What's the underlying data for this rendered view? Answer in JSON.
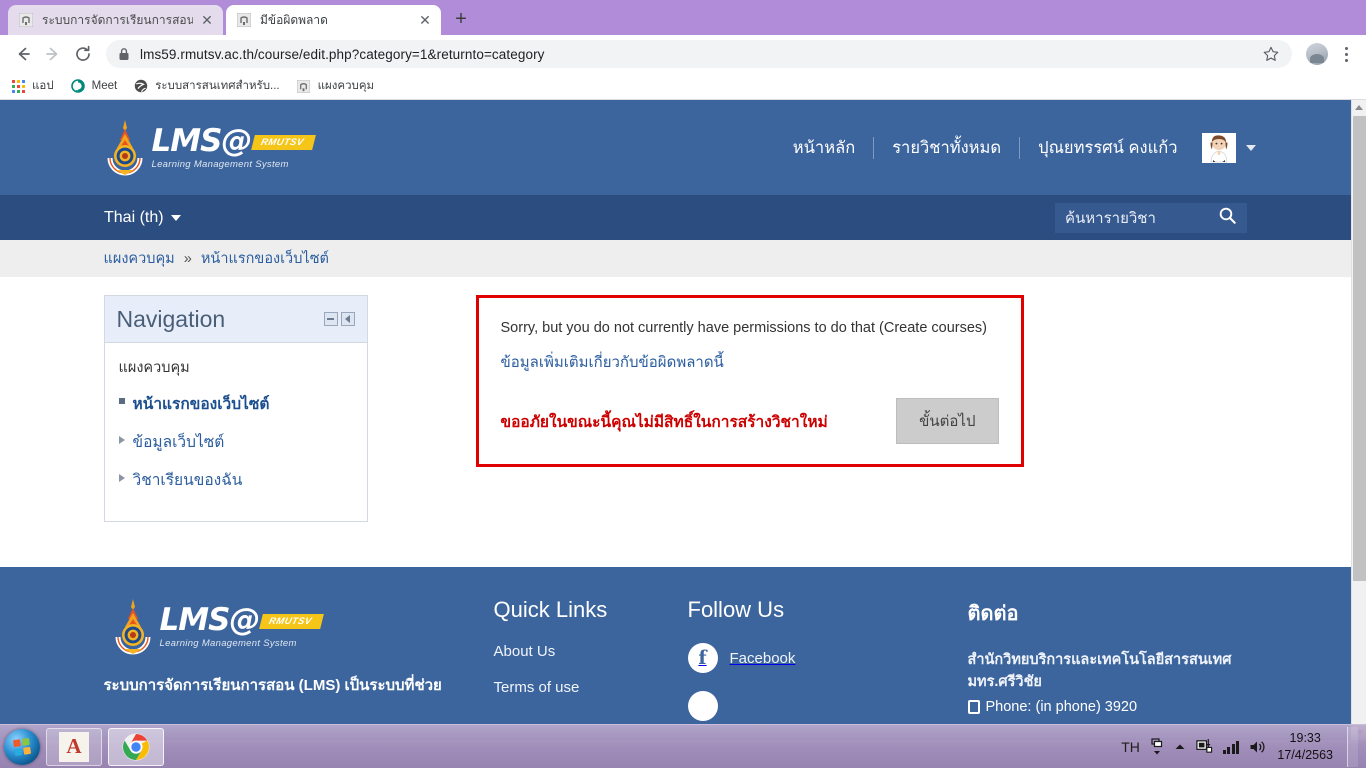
{
  "browser": {
    "tabs": [
      {
        "title": "ระบบการจัดการเรียนการสอน มหาวิทย",
        "favicon": "moodle-favicon",
        "active": false
      },
      {
        "title": "มีข้อผิดพลาด",
        "favicon": "moodle-favicon",
        "active": true
      }
    ],
    "newtab_label": "+",
    "close_label": "✕",
    "nav": {
      "back": "back-arrow",
      "forward": "forward-arrow",
      "reload": "reload-icon"
    },
    "omnibox": {
      "url": "lms59.rmutsv.ac.th/course/edit.php?category=1&returnto=category",
      "lock_icon": "lock-icon"
    },
    "bookmarks": [
      {
        "label": "แอป",
        "icon": "apps-grid-icon"
      },
      {
        "label": "Meet",
        "icon": "meet-icon"
      },
      {
        "label": "ระบบสารสนเทศสำหรับ...",
        "icon": "globe-icon"
      },
      {
        "label": "แผงควบคุม",
        "icon": "moodle-favicon"
      }
    ]
  },
  "site": {
    "logo": {
      "word": "LMS@",
      "badge": "RMUTSV",
      "subtitle": "Learning Management System"
    },
    "header_nav": [
      {
        "label": "หน้าหลัก"
      },
      {
        "label": "รายวิชาทั้งหมด"
      },
      {
        "label": "ปุณยทรรศน์ คงแก้ว"
      }
    ],
    "language": "Thai (th)",
    "search": {
      "placeholder": "ค้นหารายวิชา",
      "icon": "search-icon"
    },
    "breadcrumb": {
      "root": "แผงควบคุม",
      "separator": "»",
      "current": "หน้าแรกของเว็บไซต์"
    }
  },
  "navigation_block": {
    "title": "Navigation",
    "icons": {
      "collapse": "minus-icon",
      "dock": "dock-left-icon"
    },
    "root_label": "แผงควบคุม",
    "items": [
      {
        "label": "หน้าแรกของเว็บไซต์",
        "marker": "square",
        "current": true
      },
      {
        "label": "ข้อมูลเว็บไซต์",
        "marker": "triangle",
        "current": false
      },
      {
        "label": "วิชาเรียนของฉัน",
        "marker": "triangle",
        "current": false
      }
    ]
  },
  "error_box": {
    "message_en": "Sorry, but you do not currently have permissions to do that (Create courses)",
    "more_info_link": "ข้อมูลเพิ่มเติมเกี่ยวกับข้อผิดพลาดนี้",
    "message_th": "ขออภัยในขณะนี้คุณไม่มีสิทธิ์ในการสร้างวิชาใหม่",
    "continue_button": "ขั้นต่อไป",
    "border_color": "#e10000",
    "th_text_color": "#cc0000"
  },
  "footer": {
    "description": "ระบบการจัดการเรียนการสอน (LMS) เป็นระบบที่ช่วย",
    "quick_links": {
      "heading": "Quick Links",
      "items": [
        {
          "label": "About Us"
        },
        {
          "label": "Terms of use"
        }
      ]
    },
    "follow_us": {
      "heading": "Follow Us",
      "items": [
        {
          "label": "Facebook",
          "icon": "facebook-icon"
        }
      ]
    },
    "contact": {
      "heading": "ติดต่อ",
      "line1": "สำนักวิทยบริการและเทคโนโลยีสารสนเทศ",
      "line2": "มทร.ศรีวิชัย",
      "phone": "Phone: (in phone) 3920"
    }
  },
  "taskbar": {
    "start": "windows-start-orb",
    "items": [
      {
        "name": "acad-app",
        "label": "A"
      },
      {
        "name": "chrome-app",
        "label": ""
      }
    ],
    "tray": {
      "language": "TH",
      "time": "19:33",
      "date": "17/4/2563"
    }
  },
  "colors": {
    "header_blue": "#3d659d",
    "subbar_blue": "#2b4d80",
    "link_blue": "#2a5d9f",
    "accent_yellow": "#f5c518",
    "error_red": "#e10000"
  }
}
